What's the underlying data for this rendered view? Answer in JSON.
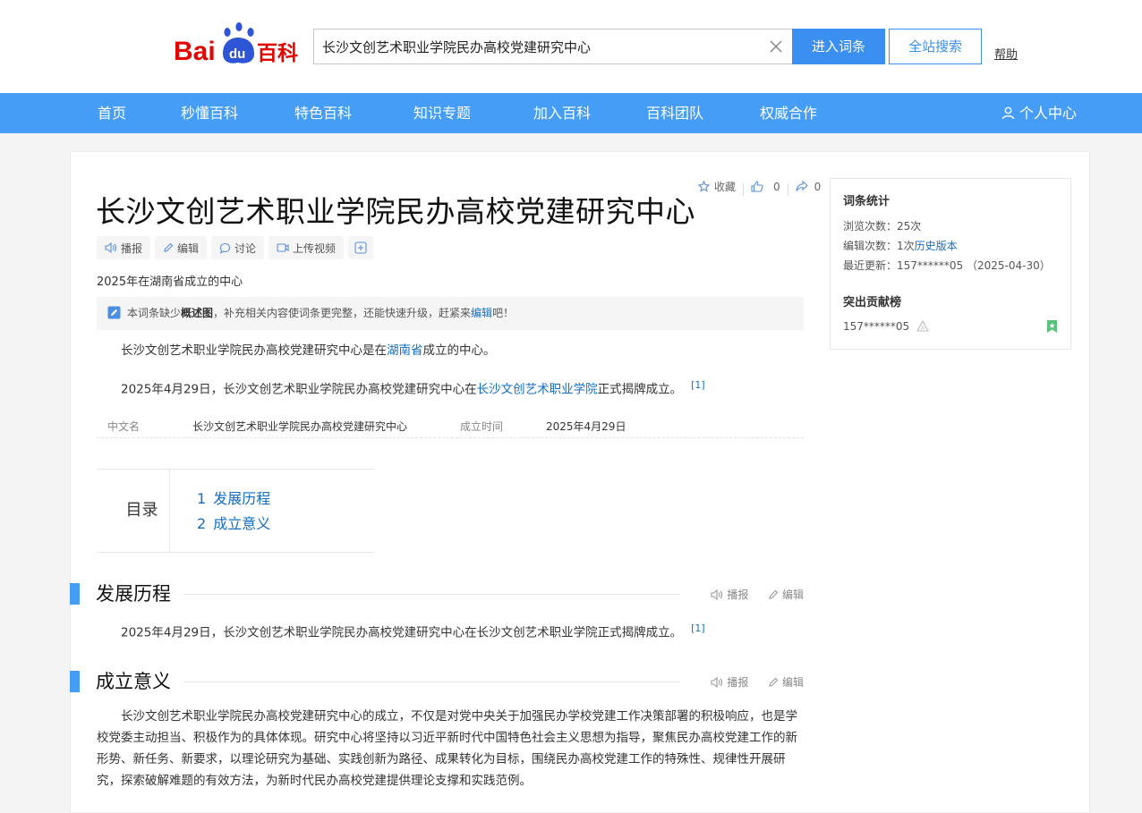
{
  "header": {
    "logo_text": "Bai du 百科",
    "search_value": "长沙文创艺术职业学院民办高校党建研究中心",
    "enter_label": "进入词条",
    "site_search_label": "全站搜索",
    "help_label": "帮助",
    "brand_blue": "#3a8ff0",
    "logo_red": "#e10601"
  },
  "nav": {
    "items": [
      "首页",
      "秒懂百科",
      "特色百科",
      "知识专题",
      "加入百科",
      "百科团队",
      "权威合作"
    ],
    "user_center": "个人中心",
    "bg_color": "#459df5"
  },
  "top_actions": {
    "collect": "收藏",
    "like_count": "0",
    "share_count": "0"
  },
  "article": {
    "title": "长沙文创艺术职业学院民办高校党建研究中心",
    "tools": [
      "播报",
      "编辑",
      "讨论",
      "上传视频"
    ],
    "subtitle": "2025年在湖南省成立的中心",
    "notice": {
      "prefix": "本词条缺少",
      "bold": "概述图",
      "middle": "，补充相关内容使词条更完整，还能快速升级，赶紧来",
      "link": "编辑",
      "suffix": "吧！"
    },
    "summary1": {
      "pre": "长沙文创艺术职业学院民办高校党建研究中心是在",
      "link": "湖南省",
      "post": "成立的中心。"
    },
    "summary2": {
      "pre": "2025年4月29日，长沙文创艺术职业学院民办高校党建研究中心在",
      "link": "长沙文创艺术职业学院",
      "post": "正式揭牌成立。",
      "ref": "[1]"
    },
    "basic_info": {
      "name_label": "中文名",
      "name_value": "长沙文创艺术职业学院民办高校党建研究中心",
      "date_label": "成立时间",
      "date_value": "2025年4月29日"
    },
    "toc": {
      "title": "目录",
      "items": [
        {
          "num": "1",
          "label": "发展历程"
        },
        {
          "num": "2",
          "label": "成立意义"
        }
      ]
    },
    "sections": [
      {
        "title": "发展历程",
        "broadcast": "播报",
        "edit": "编辑",
        "text": "2025年4月29日，长沙文创艺术职业学院民办高校党建研究中心在长沙文创艺术职业学院正式揭牌成立。",
        "ref": "[1]"
      },
      {
        "title": "成立意义",
        "broadcast": "播报",
        "edit": "编辑",
        "text": "长沙文创艺术职业学院民办高校党建研究中心的成立，不仅是对党中央关于加强民办学校党建工作决策部署的积极响应，也是学校党委主动担当、积极作为的具体体现。研究中心将坚持以习近平新时代中国特色社会主义思想为指导，聚焦民办高校党建工作的新形势、新任务、新要求，以理论研究为基础、实践创新为路径、成果转化为目标，围绕民办高校党建工作的特殊性、规律性开展研究，探索破解难题的有效方法，为新时代民办高校党建提供理论支撑和实践范例。"
      }
    ]
  },
  "sidebar": {
    "stats_title": "词条统计",
    "views": "浏览次数：25次",
    "edits_pre": "编辑次数：1次",
    "edits_link": "历史版本",
    "updated": "最近更新：157******05 （2025-04-30）",
    "contrib_title": "突出贡献榜",
    "contributor": "157******05"
  }
}
